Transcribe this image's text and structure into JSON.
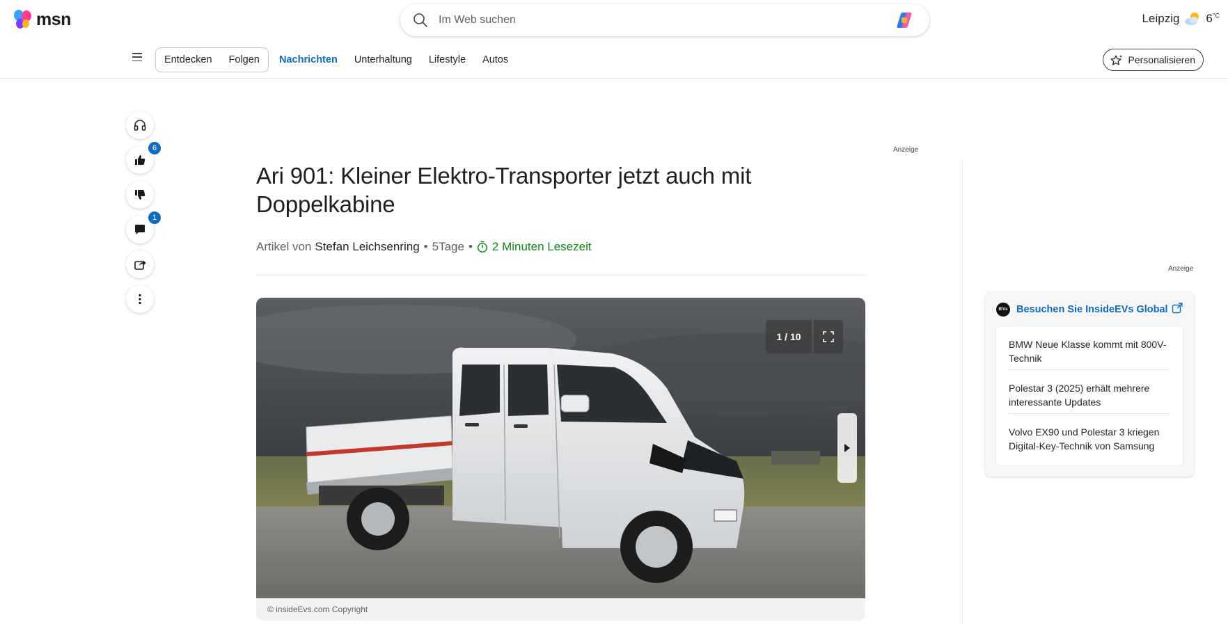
{
  "header": {
    "logo_text": "msn",
    "search_placeholder": "Im Web suchen",
    "location": "Leipzig",
    "temperature": "6",
    "temperature_unit": "°C"
  },
  "nav": {
    "pills": [
      "Entdecken",
      "Folgen"
    ],
    "links": [
      "Nachrichten",
      "Unterhaltung",
      "Lifestyle",
      "Autos"
    ],
    "active_link": "Nachrichten",
    "personalize_label": "Personalisieren"
  },
  "actions": {
    "likes_count": "6",
    "comments_count": "1",
    "icons": [
      "headphones-icon",
      "thumbs-up-icon",
      "thumbs-down-icon",
      "comment-icon",
      "share-icon",
      "more-icon"
    ]
  },
  "ad_label": "Anzeige",
  "article": {
    "title": "Ari 901: Kleiner Elektro-Transporter jetzt auch mit Doppelkabine",
    "byline_prefix": "Artikel von",
    "author": "Stefan Leichsenring",
    "age": "5Tage",
    "read_time": "2 Minuten Lesezeit",
    "image_counter": "1 / 10",
    "image_caption": "© insideEvs.com Copyright"
  },
  "source_card": {
    "title": "Besuchen Sie InsideEVs Global",
    "logo_text": "IEVs",
    "items": [
      "BMW Neue Klasse kommt mit 800V-Technik",
      "Polestar 3 (2025) erhält mehrere interessante Updates",
      "Volvo EX90 und Polestar 3 kriegen Digital-Key-Technik von Samsung"
    ]
  },
  "colors": {
    "accent": "#0f6cbd",
    "read_time": "#0e8a16"
  }
}
